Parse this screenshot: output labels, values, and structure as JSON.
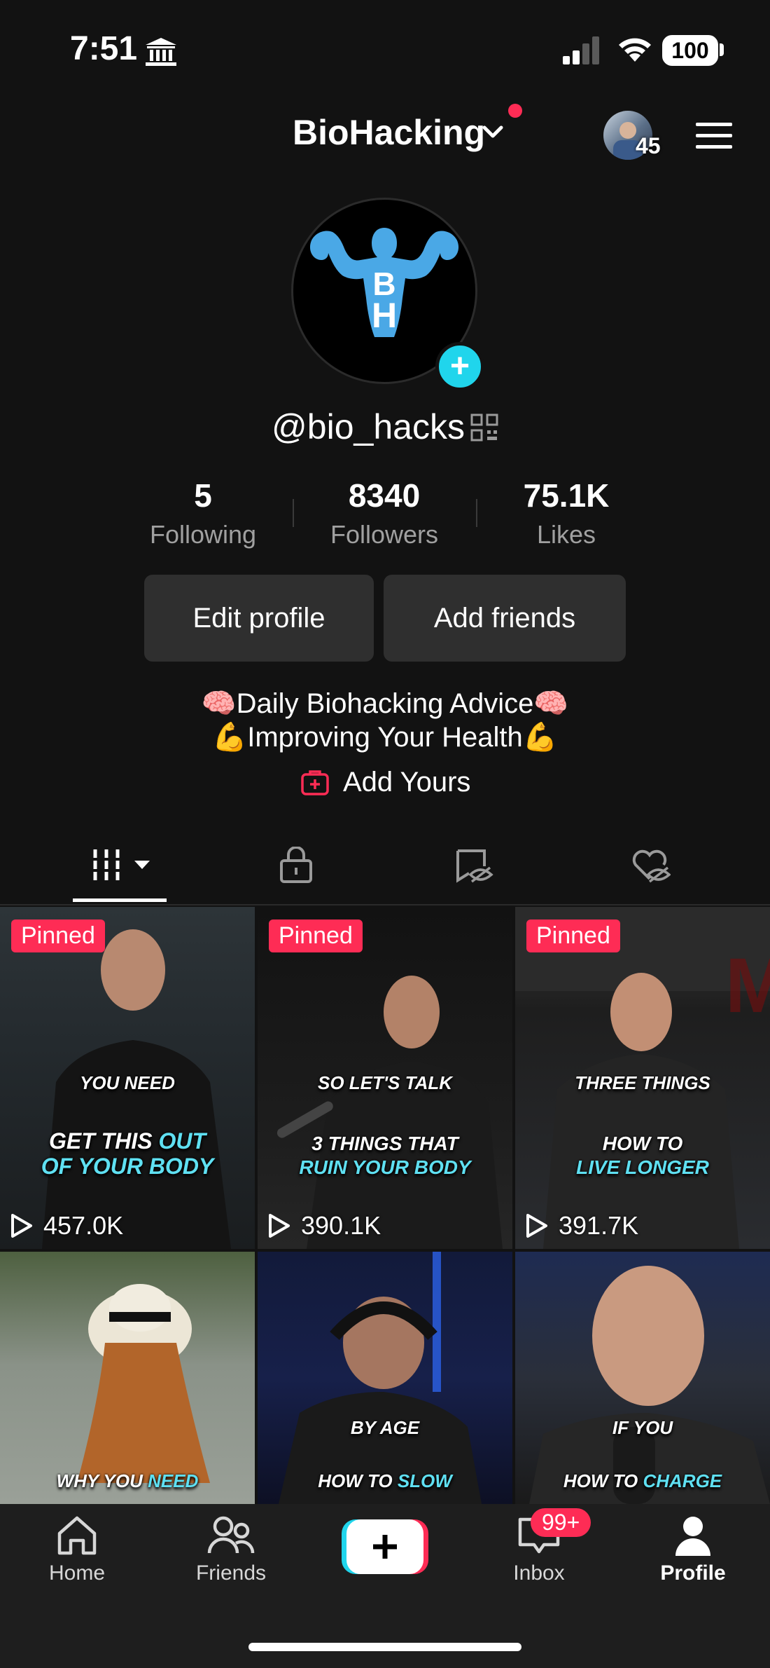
{
  "status_bar": {
    "time": "7:51",
    "battery": "100",
    "bank_icon": "bank-icon",
    "signal_icon": "signal-icon",
    "wifi_icon": "wifi-icon"
  },
  "header": {
    "account_name": "BioHacking",
    "switch_icon": "chevron-down-icon",
    "notification_dot_color": "#fe2c55",
    "viewer_count": "45",
    "menu_icon": "hamburger-menu-icon"
  },
  "profile": {
    "avatar_letters": [
      "B",
      "H"
    ],
    "username": "@bio_hacks",
    "stats": [
      {
        "value": "5",
        "label": "Following"
      },
      {
        "value": "8340",
        "label": "Followers"
      },
      {
        "value": "75.1K",
        "label": "Likes"
      }
    ],
    "buttons": {
      "edit": "Edit profile",
      "add_friends": "Add friends"
    },
    "bio_line1": "🧠Daily Biohacking Advice🧠",
    "bio_line2": "💪Improving Your Health💪",
    "add_yours": "Add Yours"
  },
  "tabs": [
    "videos-grid-icon",
    "lock-icon",
    "reposts-hidden-icon",
    "liked-hidden-icon"
  ],
  "videos": [
    {
      "pinned": "Pinned",
      "cap_top": "YOU NEED",
      "cap_a": [
        "GET THIS ",
        "OUT"
      ],
      "cap_b": "OF YOUR BODY",
      "views": "457.0K"
    },
    {
      "pinned": "Pinned",
      "cap_top": "SO LET'S TALK",
      "cap_a": [
        "3 THINGS THAT",
        ""
      ],
      "cap_b": "RUIN YOUR BODY",
      "views": "390.1K"
    },
    {
      "pinned": "Pinned",
      "cap_top": "THREE THINGS",
      "cap_a": [
        "HOW TO",
        ""
      ],
      "cap_b": "LIVE LONGER",
      "views": "391.7K"
    },
    {
      "cap_top": "",
      "cap_bottom": [
        "WHY YOU ",
        "NEED"
      ]
    },
    {
      "cap_top": "BY AGE",
      "cap_bottom": [
        "HOW TO ",
        "SLOW"
      ]
    },
    {
      "cap_top": "IF YOU",
      "cap_bottom": [
        "HOW TO ",
        "CHARGE"
      ]
    }
  ],
  "bottom_nav": {
    "home": "Home",
    "friends": "Friends",
    "inbox": "Inbox",
    "inbox_badge": "99+",
    "profile": "Profile"
  },
  "colors": {
    "accent": "#fe2c55",
    "cyan": "#20d5ec",
    "background": "#121212"
  }
}
